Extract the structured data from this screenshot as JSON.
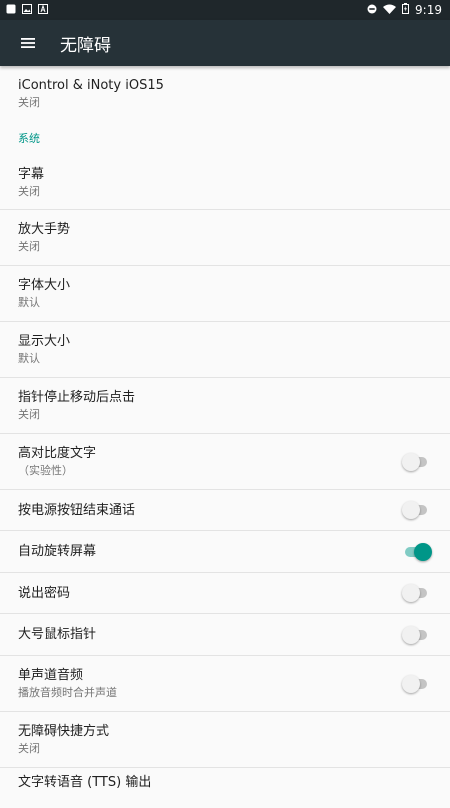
{
  "status_bar": {
    "time": "9:19"
  },
  "toolbar": {
    "title": "无障碍"
  },
  "top_item": {
    "title": "iControl & iNoty iOS15",
    "summary": "关闭"
  },
  "section": {
    "label": "系统"
  },
  "items": [
    {
      "title": "字幕",
      "summary": "关闭"
    },
    {
      "title": "放大手势",
      "summary": "关闭"
    },
    {
      "title": "字体大小",
      "summary": "默认"
    },
    {
      "title": "显示大小",
      "summary": "默认"
    },
    {
      "title": "指针停止移动后点击",
      "summary": "关闭"
    }
  ],
  "toggles": [
    {
      "title": "高对比度文字",
      "summary": "（实验性）",
      "on": false
    },
    {
      "title": "按电源按钮结束通话",
      "summary": "",
      "on": false
    },
    {
      "title": "自动旋转屏幕",
      "summary": "",
      "on": true
    },
    {
      "title": "说出密码",
      "summary": "",
      "on": false
    },
    {
      "title": "大号鼠标指针",
      "summary": "",
      "on": false
    },
    {
      "title": "单声道音频",
      "summary": "播放音频时合并声道",
      "on": false
    }
  ],
  "bottom_items": [
    {
      "title": "无障碍快捷方式",
      "summary": "关闭"
    },
    {
      "title": "文字转语音 (TTS) 输出",
      "summary": ""
    }
  ],
  "colors": {
    "accent": "#009688",
    "toolbar": "#263238",
    "status_bar": "#1f272b"
  }
}
